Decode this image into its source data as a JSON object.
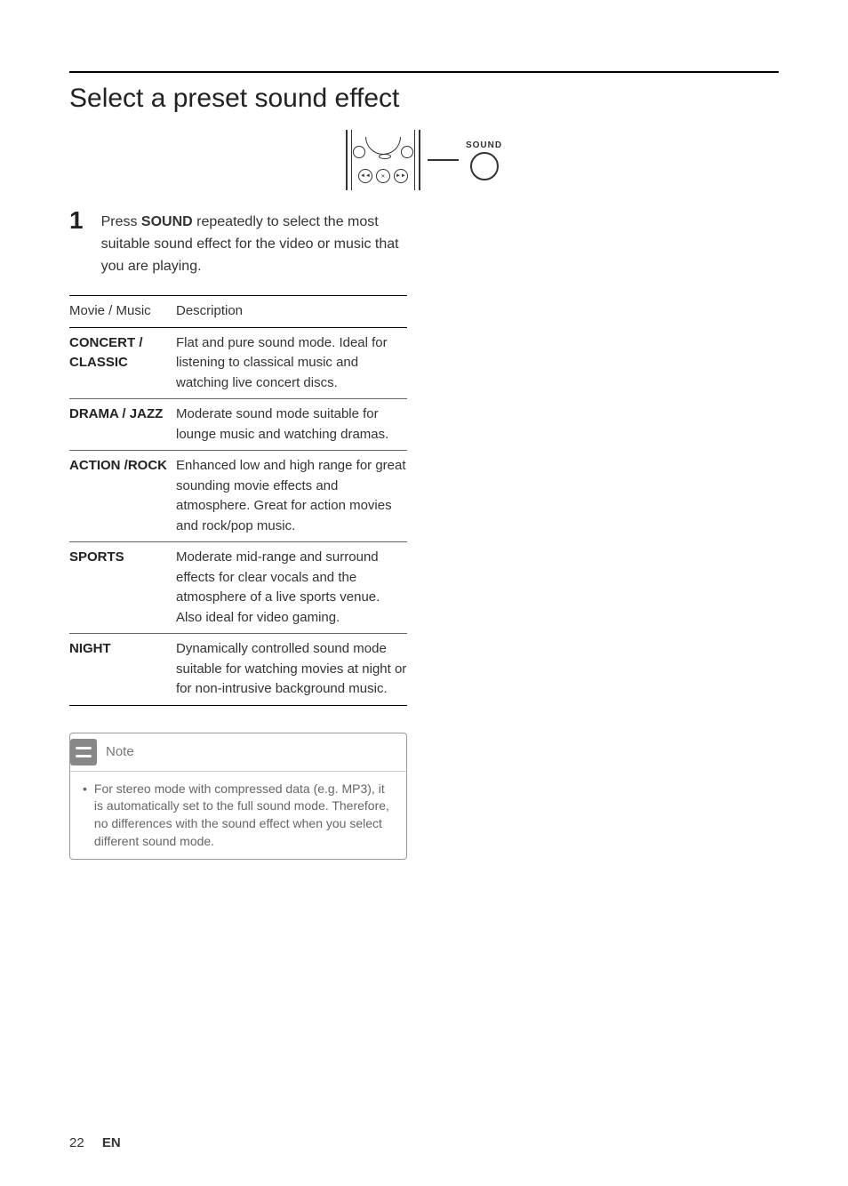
{
  "section_title": "Select a preset sound effect",
  "illustration": {
    "sound_label": "SOUND"
  },
  "step": {
    "number": "1",
    "text_pre": "Press ",
    "text_bold": "SOUND",
    "text_post": " repeatedly to select the most suitable sound effect for the video or music that you are playing."
  },
  "table": {
    "header_col1": "Movie / Music",
    "header_col2": "Description",
    "rows": [
      {
        "mode": "CONCERT / CLASSIC",
        "desc": "Flat and pure sound mode. Ideal for listening to classical music and watching live concert discs."
      },
      {
        "mode": "DRAMA / JAZZ",
        "desc": "Moderate sound mode suitable for lounge music and watching dramas."
      },
      {
        "mode": "ACTION /ROCK",
        "desc": "Enhanced low and high range for great sounding movie effects and atmosphere. Great for action movies and rock/pop music."
      },
      {
        "mode": "SPORTS",
        "desc": "Moderate mid-range and surround effects for clear vocals and the atmosphere of a live sports venue. Also ideal for video gaming."
      },
      {
        "mode": "NIGHT",
        "desc": "Dynamically controlled sound mode suitable for watching movies at night or for non-intrusive background music."
      }
    ]
  },
  "note": {
    "label": "Note",
    "bullet": "•",
    "text": "For stereo mode with compressed data (e.g. MP3), it is automatically set to the full sound mode.  Therefore, no differences with the sound effect when you select different sound mode."
  },
  "footer": {
    "page": "22",
    "lang": "EN"
  }
}
